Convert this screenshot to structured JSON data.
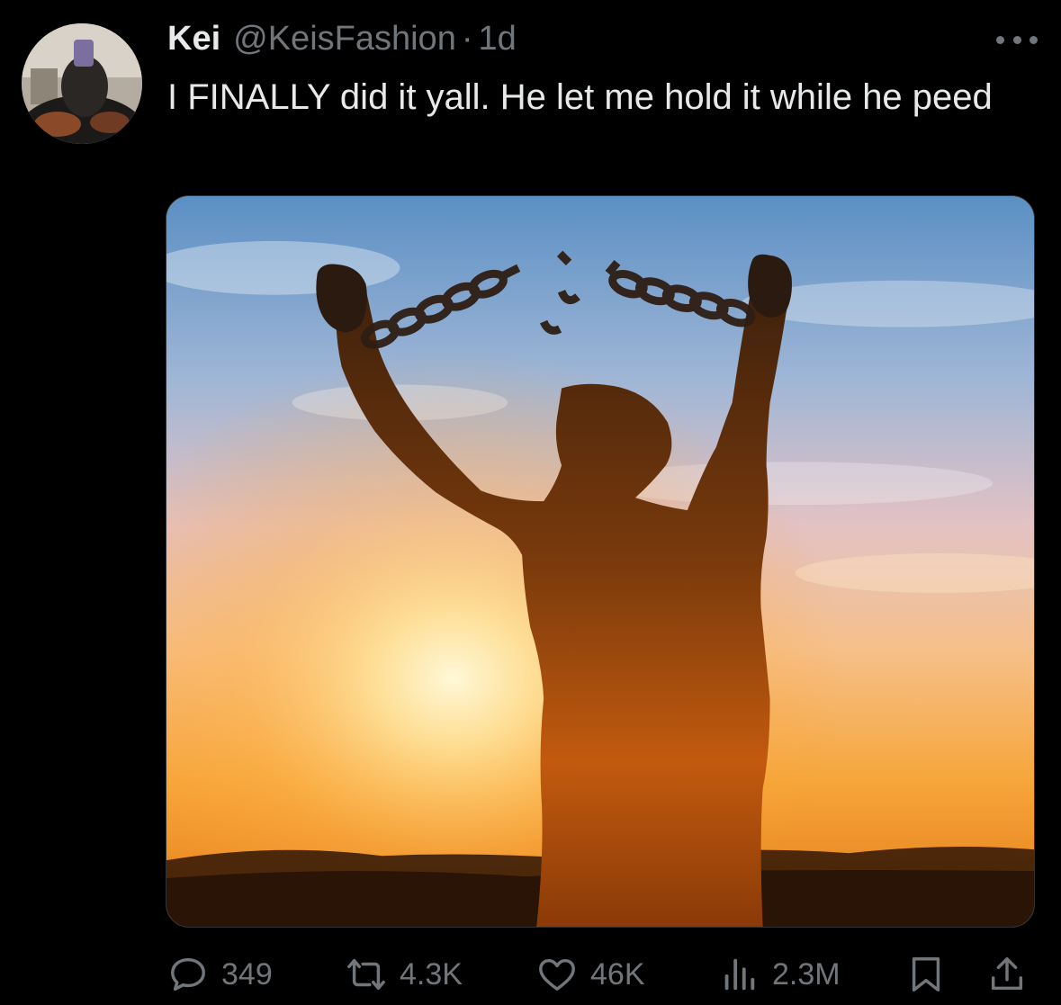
{
  "tweet": {
    "author_name": "Kei",
    "author_handle": "@KeisFashion",
    "separator": "·",
    "time": "1d",
    "text": "I FINALLY did it yall. He let me hold it while he peed"
  },
  "actions": {
    "replies": "349",
    "retweets": "4.3K",
    "likes": "46K",
    "views": "2.3M"
  },
  "icons": {
    "more": "more-dots-icon",
    "reply": "reply-icon",
    "retweet": "retweet-icon",
    "like": "heart-icon",
    "views": "views-chart-icon",
    "bookmark": "bookmark-icon",
    "share": "share-icon"
  },
  "colors": {
    "background": "#000000",
    "text_primary": "#e7e9ea",
    "text_secondary": "#71767b"
  }
}
